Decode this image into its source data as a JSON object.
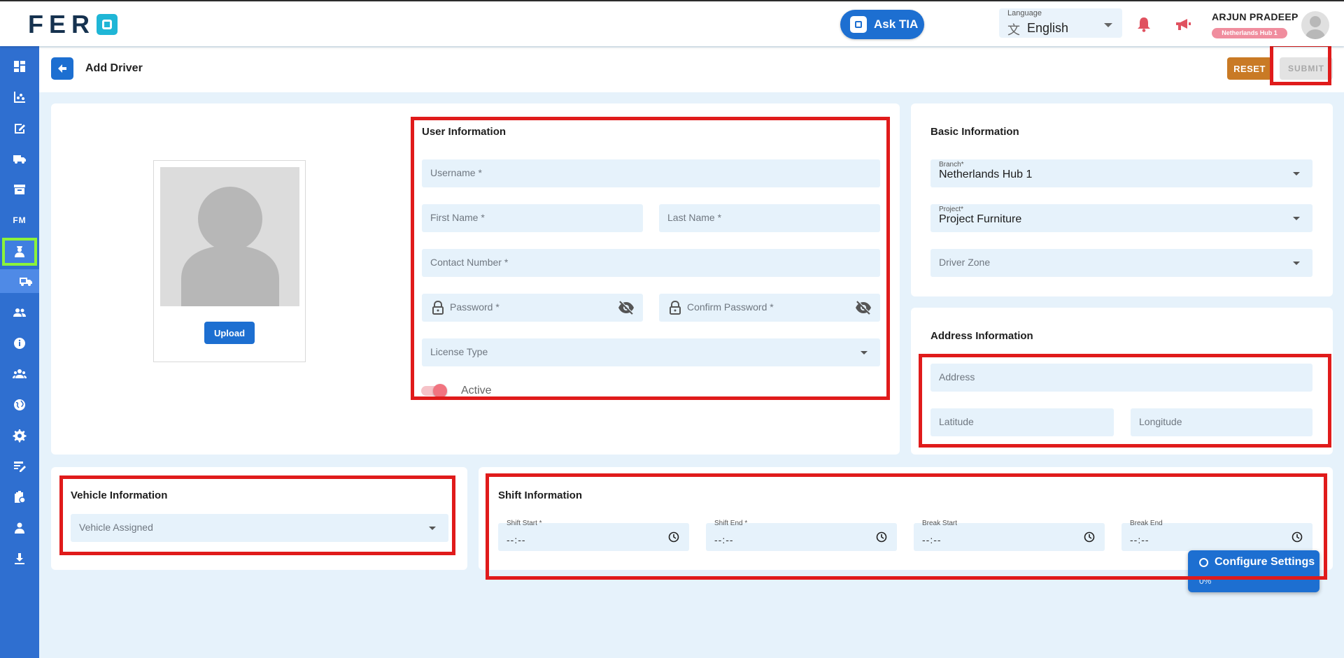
{
  "header": {
    "logo_text": "FER",
    "ask_tia_label": "Ask TIA",
    "language_label": "Language",
    "language_value": "English",
    "user_name": "ARJUN PRADEEP",
    "user_badge": "Netherlands Hub 1"
  },
  "page": {
    "title": "Add Driver",
    "reset_label": "RESET",
    "submit_label": "SUBMIT",
    "upload_label": "Upload"
  },
  "user_info": {
    "title": "User Information",
    "username_placeholder": "Username *",
    "first_name_placeholder": "First Name *",
    "last_name_placeholder": "Last Name *",
    "contact_placeholder": "Contact Number *",
    "password_placeholder": "Password *",
    "confirm_password_placeholder": "Confirm Password *",
    "license_placeholder": "License Type",
    "active_label": "Active"
  },
  "basic_info": {
    "title": "Basic Information",
    "branch_label": "Branch*",
    "branch_value": "Netherlands Hub 1",
    "project_label": "Project*",
    "project_value": "Project Furniture",
    "zone_placeholder": "Driver Zone"
  },
  "address_info": {
    "title": "Address Information",
    "address_placeholder": "Address",
    "latitude_placeholder": "Latitude",
    "longitude_placeholder": "Longitude"
  },
  "vehicle_info": {
    "title": "Vehicle Information",
    "vehicle_placeholder": "Vehicle Assigned"
  },
  "shift_info": {
    "title": "Shift Information",
    "shift_start_label": "Shift Start *",
    "shift_end_label": "Shift End *",
    "break_start_label": "Break Start",
    "break_end_label": "Break End",
    "time_placeholder": "--:--"
  },
  "configure": {
    "label": "Configure Settings",
    "sub": "0%"
  },
  "sidebar": {
    "fm_label": "FM"
  },
  "colors": {
    "primary": "#1d6fd1",
    "sidebar": "#2f6fd0",
    "reset": "#c97a25",
    "highlight_red": "#e01b1b",
    "active_green": "#8bf33a"
  }
}
